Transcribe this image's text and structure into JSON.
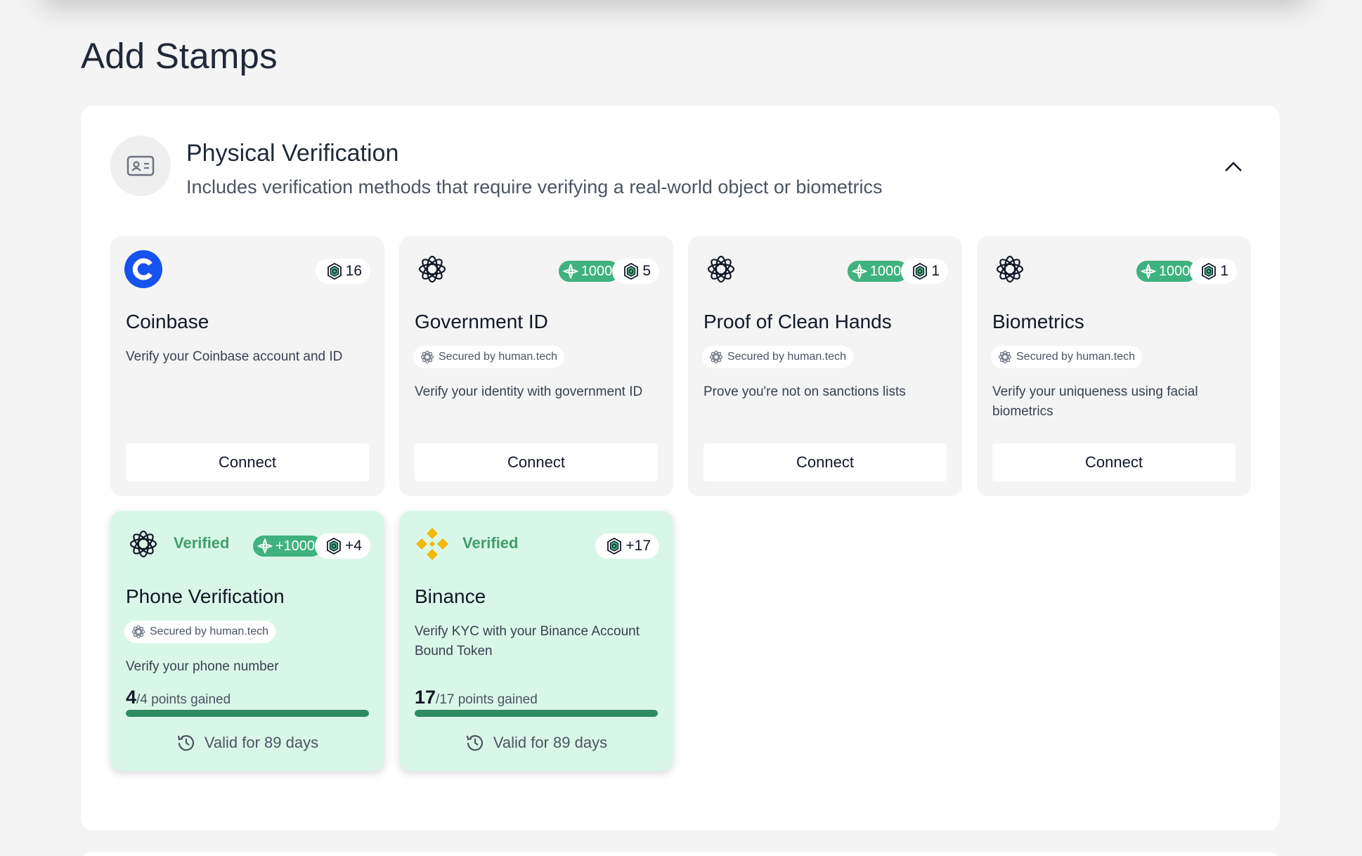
{
  "page": {
    "title": "Add Stamps"
  },
  "section": {
    "title": "Physical Verification",
    "description": "Includes verification methods that require verifying a real-world object or biometrics",
    "icon": "id-card-icon",
    "collapse_icon": "chevron-up-icon"
  },
  "colors": {
    "verified_bg": "#d9f7e8",
    "accent_green": "#3fb27f",
    "progress": "#2e8b63",
    "coinbase_blue": "#1652f0",
    "binance_gold": "#f0b90b"
  },
  "cards": [
    {
      "name": "Coinbase",
      "logo": "coinbase-logo",
      "points": "16",
      "description": "Verify your Coinbase account and ID",
      "action": "Connect"
    },
    {
      "name": "Government ID",
      "logo": "human-tech-logo",
      "human_points": "1000",
      "points": "5",
      "secured": "Secured by human.tech",
      "description": "Verify your identity with government ID",
      "action": "Connect"
    },
    {
      "name": "Proof of Clean Hands",
      "logo": "human-tech-logo",
      "human_points": "1000",
      "points": "1",
      "secured": "Secured by human.tech",
      "description": "Prove you're not on sanctions lists",
      "action": "Connect"
    },
    {
      "name": "Biometrics",
      "logo": "human-tech-logo",
      "human_points": "1000",
      "points": "1",
      "secured": "Secured by human.tech",
      "description": "Verify your uniqueness using facial biometrics",
      "action": "Connect"
    },
    {
      "name": "Phone Verification",
      "logo": "human-tech-logo",
      "status": "Verified",
      "human_points": "+1000",
      "points": "+4",
      "secured": "Secured by human.tech",
      "description": "Verify your phone number",
      "gained": "4",
      "gained_total": "/4 points gained",
      "progress": 1.0,
      "validity": "Valid for 89 days"
    },
    {
      "name": "Binance",
      "logo": "binance-logo",
      "status": "Verified",
      "points": "+17",
      "description": "Verify KYC with your Binance Account Bound Token",
      "gained": "17",
      "gained_total": "/17 points gained",
      "progress": 1.0,
      "validity": "Valid for 89 days"
    }
  ]
}
